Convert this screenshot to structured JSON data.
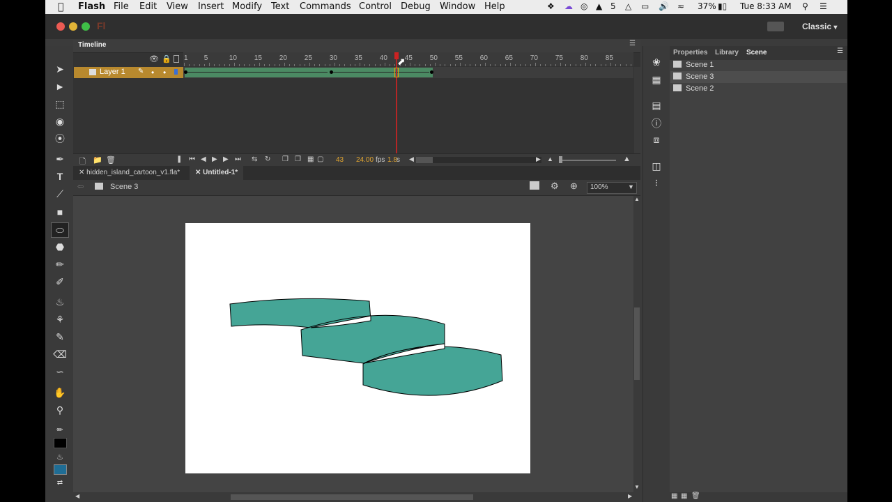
{
  "menubar": {
    "apple": "",
    "app": "Flash",
    "items": [
      "File",
      "Edit",
      "View",
      "Insert",
      "Modify",
      "Text",
      "Commands",
      "Control",
      "Debug",
      "Window",
      "Help"
    ],
    "status": {
      "adobe_count": "5",
      "battery": "37%",
      "clock": "Tue 8:33 AM"
    }
  },
  "workspace": {
    "label": "Classic",
    "app_logo": "Fl"
  },
  "timeline": {
    "title": "Timeline",
    "layer_name": "Layer 1",
    "ruler_numbers": [
      "1",
      "5",
      "10",
      "15",
      "20",
      "25",
      "30",
      "35",
      "40",
      "45",
      "50",
      "55",
      "60",
      "65",
      "70",
      "75",
      "80",
      "85"
    ],
    "current_frame": "43",
    "fps": "24.00",
    "fps_unit": "fps",
    "elapsed": "1.8",
    "elapsed_unit": "s"
  },
  "documents": {
    "tabs": [
      {
        "label": "hidden_island_cartoon_v1.fla*",
        "active": false
      },
      {
        "label": "Untitled-1*",
        "active": true
      }
    ]
  },
  "editbar": {
    "scene": "Scene 3",
    "zoom": "100%"
  },
  "right_panel": {
    "tabs": [
      "Properties",
      "Library",
      "Scene"
    ],
    "active_tab": "Scene",
    "scenes": [
      "Scene 1",
      "Scene 3",
      "Scene 2"
    ],
    "selected_scene": "Scene 3"
  },
  "colors": {
    "fill": "#45a596",
    "stroke": "#000000",
    "layer_highlight": "#b8892e",
    "tween": "#4b8a63",
    "playhead": "#b52626"
  }
}
